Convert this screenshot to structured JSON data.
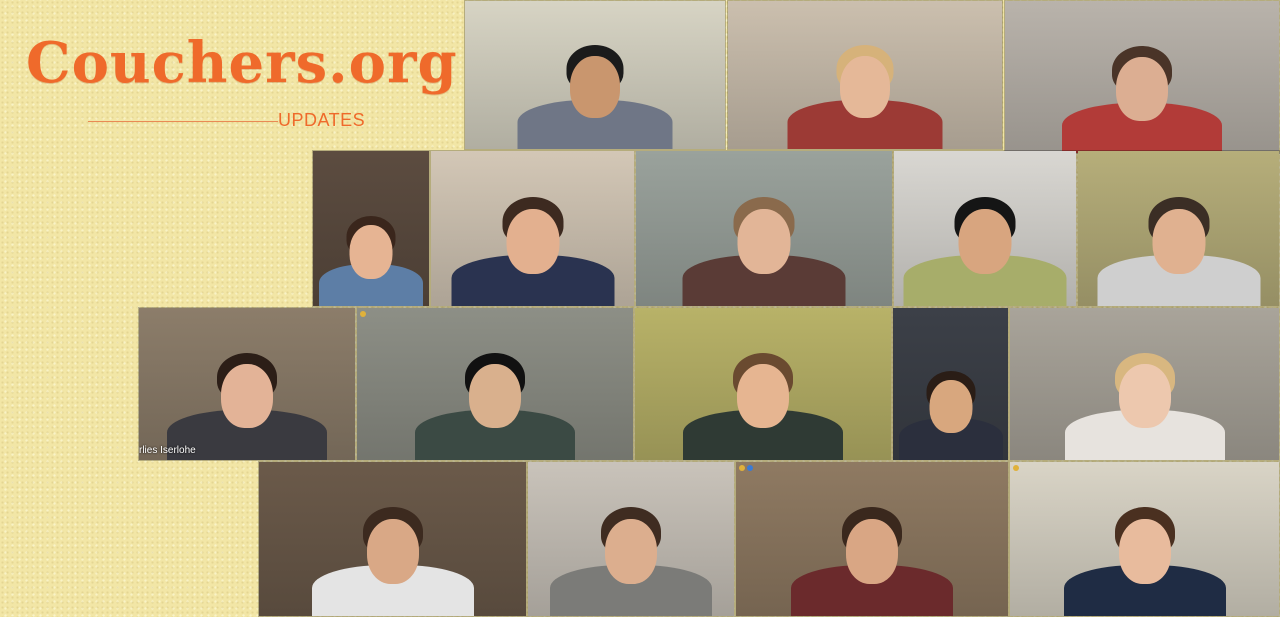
{
  "logo": {
    "title": "Couchers.org",
    "subtitle": "UPDATES"
  },
  "tiles": [
    {
      "bg": "#d7d4c4",
      "skin": "#c9966e",
      "hair": "#1b1b1b",
      "shirt": "#6f7686"
    },
    {
      "bg": "#cbbfae",
      "skin": "#e5b898",
      "hair": "#d6b27a",
      "shirt": "#9c3a35"
    },
    {
      "bg": "#b9b3ab",
      "skin": "#dcae92",
      "hair": "#4a3428",
      "shirt": "#b23b38"
    },
    {
      "bg": "#5c4c40",
      "skin": "#e6b493",
      "hair": "#3a261c",
      "shirt": "#5d7ea6"
    },
    {
      "bg": "#d3c7b6",
      "skin": "#e3b08f",
      "hair": "#3d2a20",
      "shirt": "#2a3350"
    },
    {
      "bg": "#9aa29c",
      "skin": "#e2b597",
      "hair": "#8a6a4c",
      "shirt": "#5a3b36"
    },
    {
      "bg": "#d9d7d2",
      "skin": "#d8a57f",
      "hair": "#151515",
      "shirt": "#a7ad6a"
    },
    {
      "bg": "#b6ae7a",
      "skin": "#e0b190",
      "hair": "#3b2e25",
      "shirt": "#cfcfcf"
    },
    {
      "bg": "#8c7d6a",
      "skin": "#e3b397",
      "hair": "#2c1e17",
      "shirt": "#3a3a40"
    },
    {
      "bg": "#8d8f86",
      "skin": "#d9b08d",
      "hair": "#111111",
      "shirt": "#3b4a44"
    },
    {
      "bg": "#b8b268",
      "skin": "#e6b591",
      "hair": "#6a4a30",
      "shirt": "#2f3a34"
    },
    {
      "bg": "#3c4048",
      "skin": "#d8a77e",
      "hair": "#2a1d16",
      "shirt": "#2b2f3d"
    },
    {
      "bg": "#a9a49a",
      "skin": "#edc8ae",
      "hair": "#d8b780",
      "shirt": "#e7e3de"
    },
    {
      "bg": "#6b5a4a",
      "skin": "#d9a886",
      "hair": "#3c2a1f",
      "shirt": "#e4e4e4"
    },
    {
      "bg": "#c9c3ba",
      "skin": "#dcae8e",
      "hair": "#3f2c21",
      "shirt": "#7b7b78"
    },
    {
      "bg": "#8f7a62",
      "skin": "#d9a684",
      "hair": "#3a281d",
      "shirt": "#6b2a2c"
    },
    {
      "bg": "#d9d4c6",
      "skin": "#e8bb9d",
      "hair": "#4a3020",
      "shirt": "#1f2c44"
    }
  ],
  "participants": [
    {
      "name_label": ""
    },
    {
      "name_label": ""
    },
    {
      "name_label": ""
    },
    {
      "name_label": ""
    },
    {
      "name_label": ""
    },
    {
      "name_label": ""
    },
    {
      "name_label": ""
    },
    {
      "name_label": ""
    },
    {
      "name_label": "rlies Iserlohe"
    },
    {
      "name_label": ""
    },
    {
      "name_label": ""
    },
    {
      "name_label": ""
    },
    {
      "name_label": ""
    },
    {
      "name_label": ""
    },
    {
      "name_label": ""
    },
    {
      "name_label": ""
    },
    {
      "name_label": ""
    }
  ],
  "status_dot_color": "#e0b13a",
  "status_dot_alt_color": "#3a7bd5"
}
